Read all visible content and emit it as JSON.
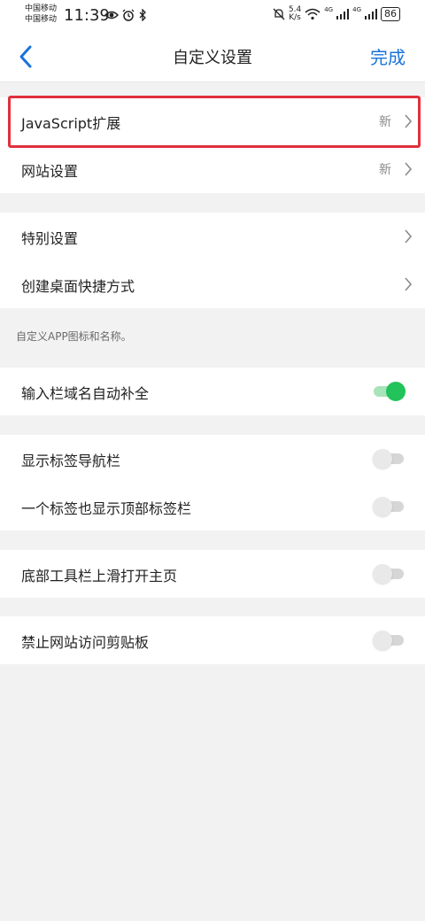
{
  "status_bar": {
    "carrier1": "中国移动",
    "carrier2": "中国移动",
    "time": "11:39",
    "speed_value": "5.4",
    "speed_unit": "K/s",
    "network1": "4G",
    "network2": "4G",
    "battery": "86"
  },
  "header": {
    "title": "自定义设置",
    "done_label": "完成",
    "back_icon": "chevron-left-icon"
  },
  "groups": [
    {
      "rows": [
        {
          "label": "JavaScript扩展",
          "badge": "新",
          "control": "chevron"
        },
        {
          "label": "网站设置",
          "badge": "新",
          "control": "chevron"
        }
      ]
    },
    {
      "rows": [
        {
          "label": "特别设置",
          "control": "chevron"
        },
        {
          "label": "创建桌面快捷方式",
          "control": "chevron"
        }
      ],
      "note": "自定义APP图标和名称。"
    },
    {
      "rows": [
        {
          "label": "输入栏域名自动补全",
          "control": "toggle",
          "on": true
        }
      ]
    },
    {
      "rows": [
        {
          "label": "显示标签导航栏",
          "control": "toggle",
          "on": false
        },
        {
          "label": "一个标签也显示顶部标签栏",
          "control": "toggle",
          "on": false
        }
      ]
    },
    {
      "rows": [
        {
          "label": "底部工具栏上滑打开主页",
          "control": "toggle",
          "on": false
        }
      ]
    },
    {
      "rows": [
        {
          "label": "禁止网站访问剪贴板",
          "control": "toggle",
          "on": false
        }
      ]
    }
  ],
  "colors": {
    "accent": "#1a73d9",
    "toggle_on": "#22c35a",
    "highlight_border": "#e0303c"
  }
}
